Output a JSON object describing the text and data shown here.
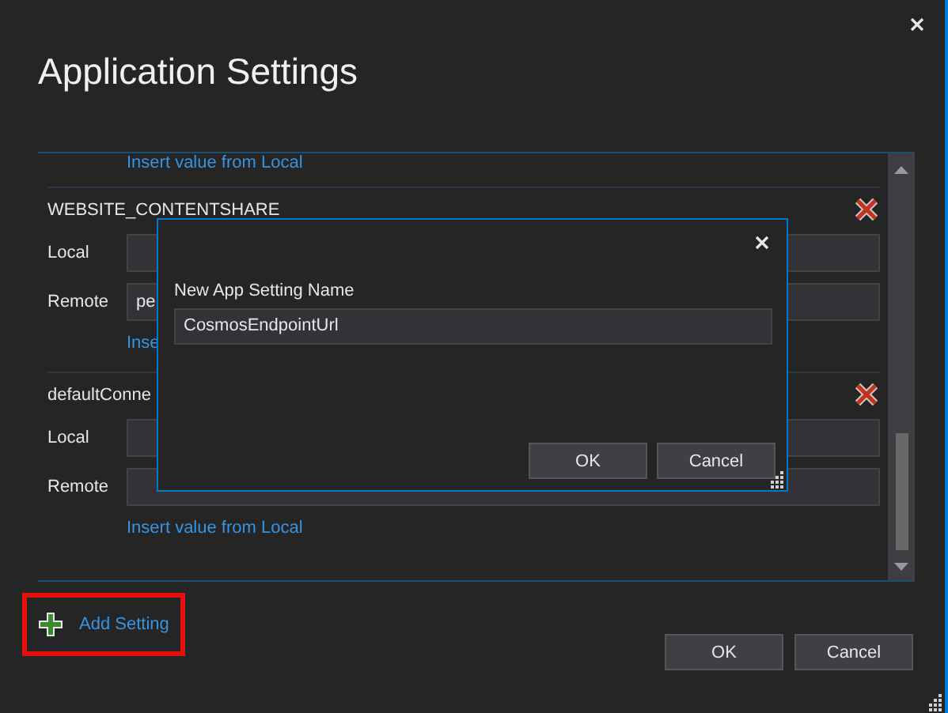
{
  "window": {
    "title": "Application Settings"
  },
  "settings": {
    "leading_link": "Insert value from Local",
    "items": [
      {
        "name": "WEBSITE_CONTENTSHARE",
        "fields": [
          {
            "label": "Local"
          },
          {
            "label": "Remote",
            "value": "pe"
          }
        ],
        "link": "Inse"
      },
      {
        "name": "defaultConne",
        "fields": [
          {
            "label": "Local"
          },
          {
            "label": "Remote"
          }
        ],
        "link": "Insert value from Local"
      }
    ]
  },
  "add_setting": {
    "label": "Add Setting",
    "highlighted": true
  },
  "buttons": [
    "OK",
    "Cancel"
  ],
  "dialog": {
    "label": "New App Setting Name",
    "value": "CosmosEndpointUrl",
    "buttons": [
      "OK",
      "Cancel"
    ]
  }
}
